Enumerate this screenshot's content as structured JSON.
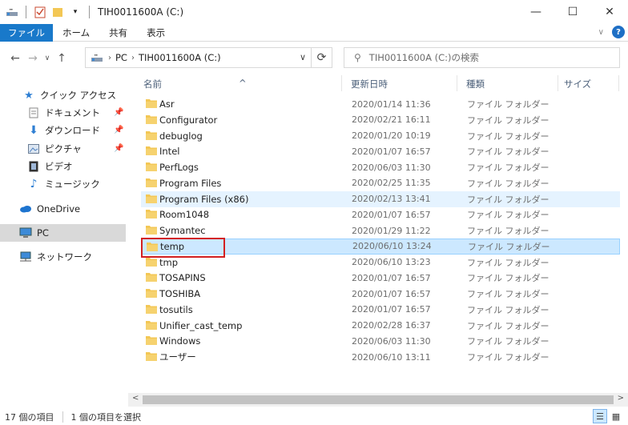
{
  "window": {
    "title": "TIH0011600A (C:)",
    "minimize": "—",
    "maximize": "☐",
    "close": "✕"
  },
  "ribbon": {
    "tabs": [
      "ファイル",
      "ホーム",
      "共有",
      "表示"
    ],
    "expand": "∨",
    "help": "?"
  },
  "address": {
    "crumbs": [
      "PC",
      "TIH0011600A (C:)"
    ],
    "search_placeholder": "TIH0011600A (C:)の検索"
  },
  "nav": {
    "quick_access": "クイック アクセス",
    "items": [
      "ドキュメント",
      "ダウンロード",
      "ピクチャ",
      "ビデオ",
      "ミュージック"
    ],
    "onedrive": "OneDrive",
    "pc": "PC",
    "network": "ネットワーク"
  },
  "columns": {
    "name": "名前",
    "date": "更新日時",
    "type": "種類",
    "size": "サイズ"
  },
  "files": [
    {
      "name": "Asr",
      "date": "2020/01/14 11:36",
      "type": "ファイル フォルダー"
    },
    {
      "name": "Configurator",
      "date": "2020/02/21 16:11",
      "type": "ファイル フォルダー"
    },
    {
      "name": "debuglog",
      "date": "2020/01/20 10:19",
      "type": "ファイル フォルダー"
    },
    {
      "name": "Intel",
      "date": "2020/01/07 16:57",
      "type": "ファイル フォルダー"
    },
    {
      "name": "PerfLogs",
      "date": "2020/06/03 11:30",
      "type": "ファイル フォルダー"
    },
    {
      "name": "Program Files",
      "date": "2020/02/25 11:35",
      "type": "ファイル フォルダー"
    },
    {
      "name": "Program Files (x86)",
      "date": "2020/02/13 13:41",
      "type": "ファイル フォルダー"
    },
    {
      "name": "Room1048",
      "date": "2020/01/07 16:57",
      "type": "ファイル フォルダー"
    },
    {
      "name": "Symantec",
      "date": "2020/01/29 11:22",
      "type": "ファイル フォルダー"
    },
    {
      "name": "temp",
      "date": "2020/06/10 13:24",
      "type": "ファイル フォルダー"
    },
    {
      "name": "tmp",
      "date": "2020/06/10 13:23",
      "type": "ファイル フォルダー"
    },
    {
      "name": "TOSAPINS",
      "date": "2020/01/07 16:57",
      "type": "ファイル フォルダー"
    },
    {
      "name": "TOSHIBA",
      "date": "2020/01/07 16:57",
      "type": "ファイル フォルダー"
    },
    {
      "name": "tosutils",
      "date": "2020/01/07 16:57",
      "type": "ファイル フォルダー"
    },
    {
      "name": "Unifier_cast_temp",
      "date": "2020/02/28 16:37",
      "type": "ファイル フォルダー"
    },
    {
      "name": "Windows",
      "date": "2020/06/03 11:30",
      "type": "ファイル フォルダー"
    },
    {
      "name": "ユーザー",
      "date": "2020/06/10 13:11",
      "type": "ファイル フォルダー"
    }
  ],
  "status": {
    "count": "17 個の項目",
    "selected": "1 個の項目を選択"
  },
  "colors": {
    "accent": "#1979ca",
    "selection": "#cce8ff",
    "highlight_box": "#d32020",
    "folder": "#f3c755"
  }
}
